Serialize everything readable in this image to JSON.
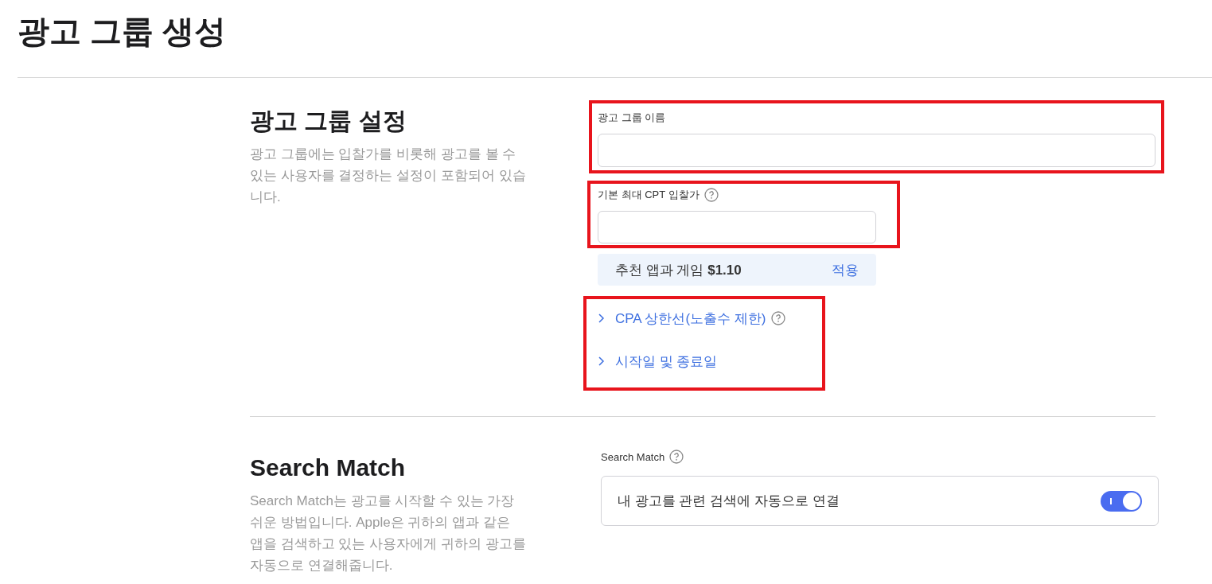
{
  "page": {
    "title": "광고 그룹 생성"
  },
  "sections": [
    {
      "title": "광고 그룹 설정",
      "description": "광고 그룹에는 입찰가를 비롯해 광고를 볼 수 있는 사용자를 결정하는 설정이 포함되어 있습니다.",
      "groups": [
        {
          "kind": "name-field",
          "highlighted": true,
          "label": "광고 그룹 이름",
          "help": false
        },
        {
          "kind": "bid-field",
          "highlighted": true,
          "label": "기본 최대 CPT 입찰가",
          "help": true,
          "suggestion": {
            "label": "추천 앱과 게임",
            "amount": "$1.10",
            "action": "적용"
          }
        },
        {
          "kind": "options",
          "highlighted": true,
          "links": [
            {
              "label": "CPA 상한선(노출수 제한)",
              "help": true,
              "expanded": false
            },
            {
              "label": "시작일 및 종료일",
              "help": false,
              "expanded": false
            }
          ]
        }
      ]
    },
    {
      "title": "Search Match",
      "description": "Search Match는 광고를 시작할 수 있는 가장 쉬운 방법입니다. Apple은 귀하의 앱과 같은 앱을 검색하고 있는 사용자에게 귀하의 광고를 자동으로 연결해줍니다.",
      "groups": [
        {
          "kind": "toggle",
          "label": "Search Match",
          "help": true,
          "option": "내 광고를 관련 검색에 자동으로 연결",
          "on": true
        }
      ]
    }
  ]
}
